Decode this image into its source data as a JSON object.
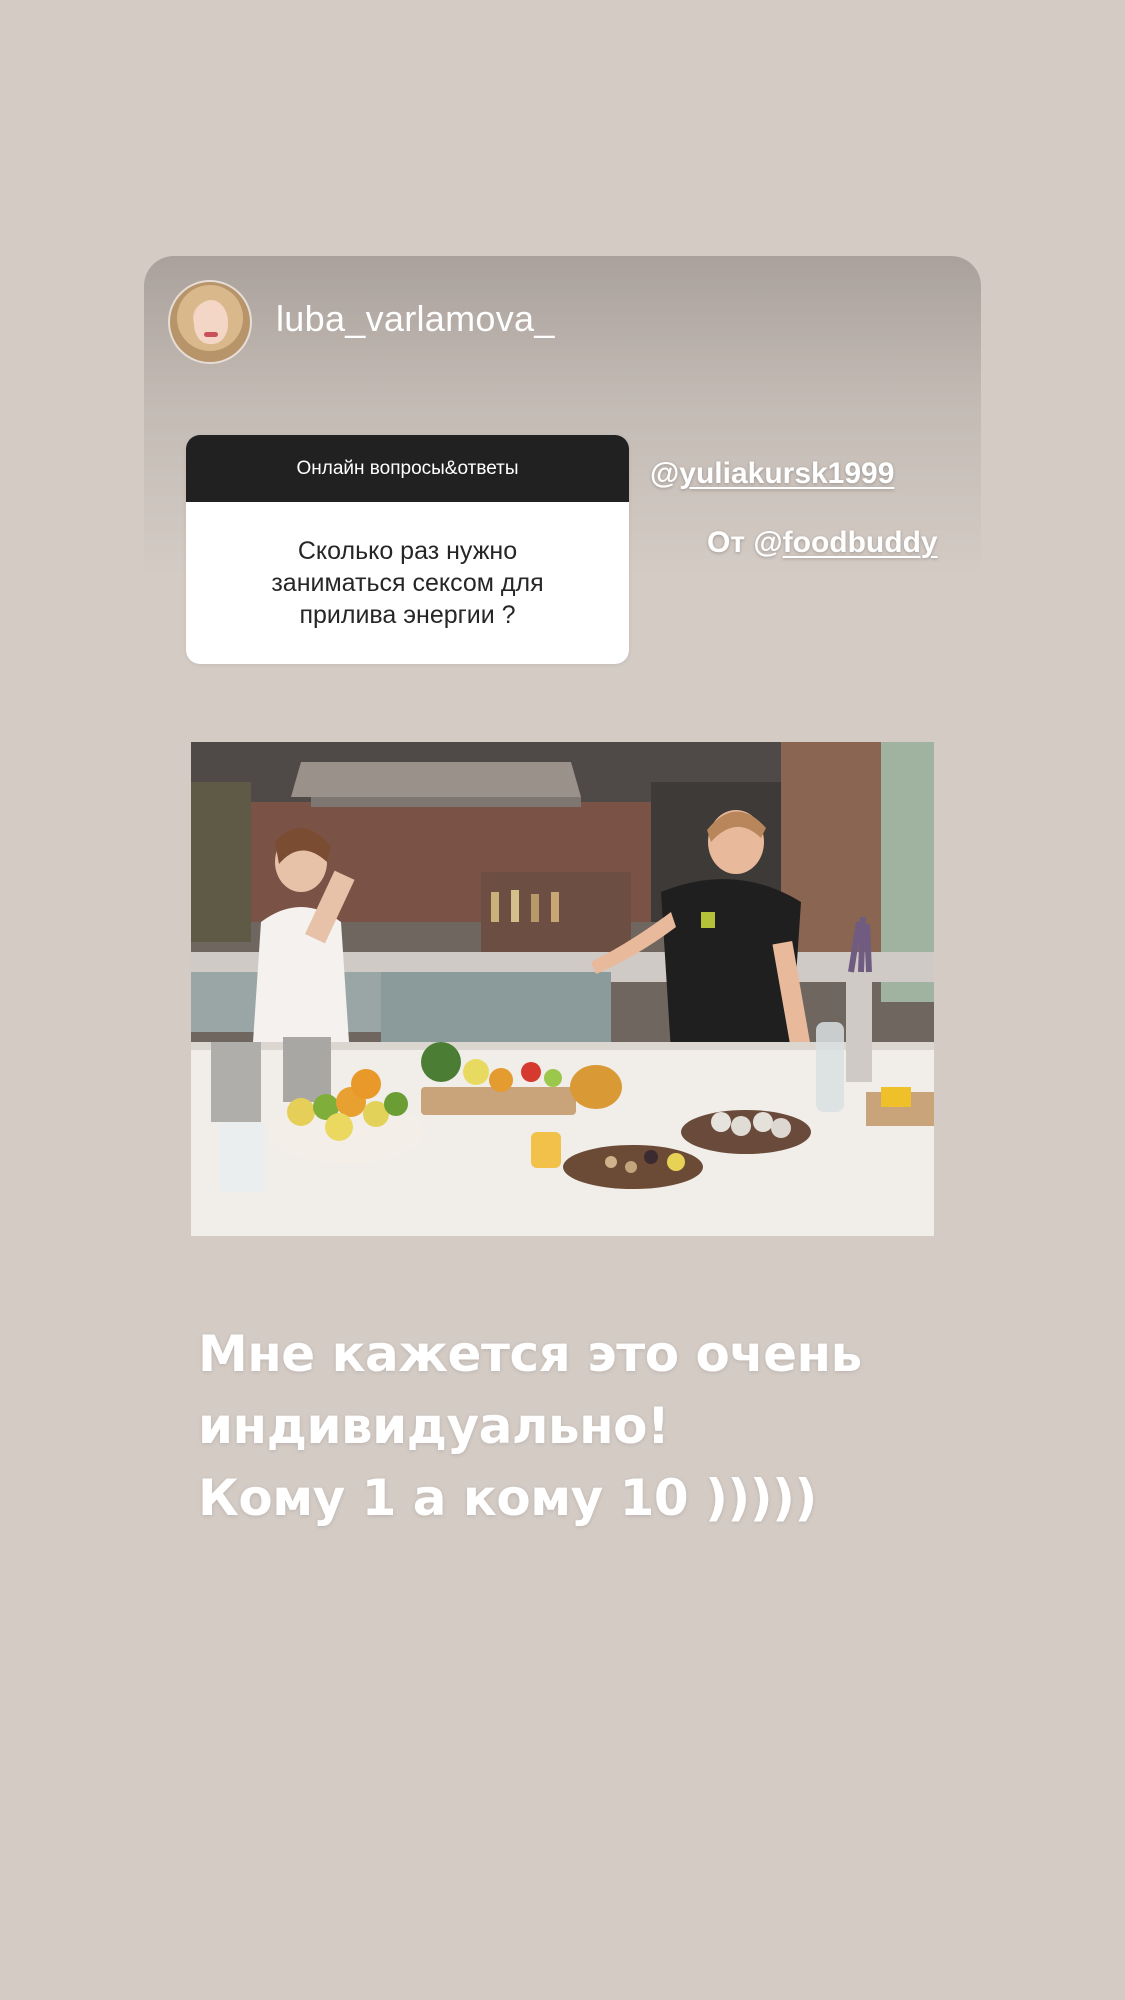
{
  "header": {
    "username": "luba_varlamova_"
  },
  "question_sticker": {
    "title": "Онлайн вопросы&ответы",
    "question": "Сколько раз нужно заниматься сексом для прилива энергии ?"
  },
  "mention": {
    "at": "@",
    "handle": "yuliakursk1999"
  },
  "from": {
    "prefix": "От @",
    "handle": "foodbuddy"
  },
  "answer": {
    "lines": [
      "Мне кажется это очень",
      "индивидуально!",
      "Кому 1 а кому 10 )))))"
    ]
  },
  "colors": {
    "background": "#d4cbc5",
    "sticker_header": "#212121",
    "text_white": "#ffffff"
  }
}
